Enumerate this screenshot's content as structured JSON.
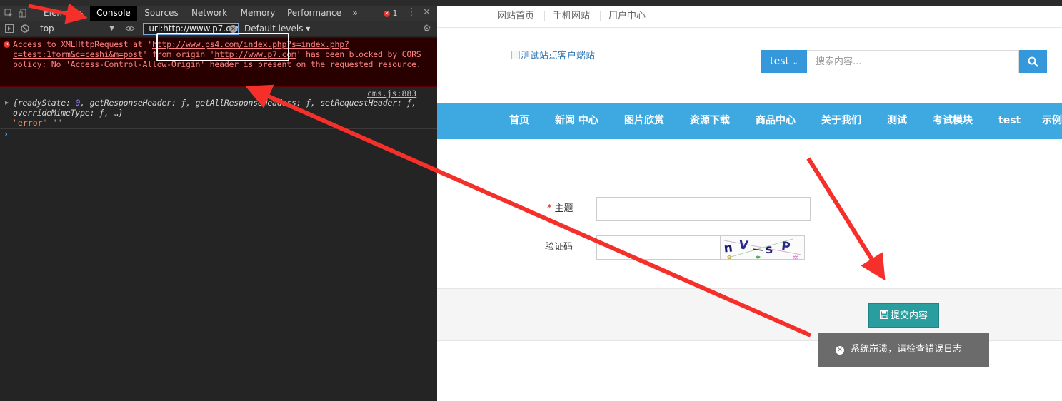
{
  "devtools": {
    "tabs": [
      "Elements",
      "Console",
      "Sources",
      "Network",
      "Memory",
      "Performance"
    ],
    "more_tabs": "»",
    "error_count": "1",
    "context": "top",
    "filter_value": "-url:http://www.p7.com",
    "levels": "Default levels ▾",
    "error_message": {
      "part1": "Access to XMLHttpRequest at '",
      "url1": "http://www.ps4.com/index.php?s=",
      "part2": "",
      "url2": "index.php?c=test:1form&c=ceshi&m=post",
      "part3": "' from origin '",
      "origin": "http://www.p7.com",
      "part4": "' has been blocked by CORS policy: No 'Access-Control-Allow-Origin' header is present on the requested resource."
    },
    "log_source": "cms.js:883",
    "log_object_a": "{readyState: ",
    "log_object_num": "0",
    "log_object_b": ", getResponseHeader: ƒ, getAllResponseHeaders: ƒ, setRequestHeader: ƒ, overrideMimeType: ƒ, …}",
    "log_string_val": "\"error\"",
    "log_string_rest": " \"\"",
    "prompt": "›"
  },
  "site": {
    "top_links": [
      "网站首页",
      "手机网站",
      "用户中心"
    ],
    "logo_alt": "测试站点客户端站",
    "search": {
      "select_label": "test",
      "placeholder": "搜索内容..."
    },
    "nav": [
      "首页",
      "新闻 中心",
      "图片欣赏",
      "资源下载",
      "商品中心",
      "关于我们",
      "测试",
      "考试模块",
      "test",
      "示例"
    ],
    "form": {
      "subject_label": "主题",
      "required_mark": "*",
      "captcha_label": "验证码",
      "captcha_text": "nV SP"
    },
    "submit_label": "提交内容",
    "toast_text": "系统崩溃，请检查错误日志"
  },
  "colors": {
    "nav_blue": "#3ea9e1",
    "search_blue": "#3498db",
    "submit_teal": "#2a9d9f",
    "arrow_red": "#f5302b",
    "error_red": "#fe8181"
  }
}
